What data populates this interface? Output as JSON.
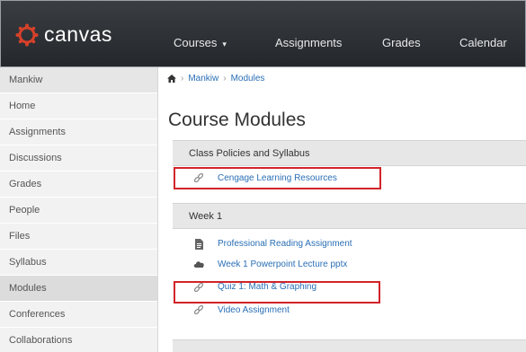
{
  "app": {
    "logo_text": "canvas",
    "accent": "#d6412a"
  },
  "topnav": {
    "items": [
      {
        "label": "Courses",
        "caret": "▾"
      },
      {
        "label": "Assignments"
      },
      {
        "label": "Grades"
      },
      {
        "label": "Calendar"
      }
    ]
  },
  "sidebar": {
    "course_name": "Mankiw",
    "items": [
      {
        "label": "Home"
      },
      {
        "label": "Assignments"
      },
      {
        "label": "Discussions"
      },
      {
        "label": "Grades"
      },
      {
        "label": "People"
      },
      {
        "label": "Files"
      },
      {
        "label": "Syllabus"
      },
      {
        "label": "Modules"
      },
      {
        "label": "Conferences"
      },
      {
        "label": "Collaborations"
      }
    ]
  },
  "breadcrumb": {
    "items": [
      "Mankiw",
      "Modules"
    ],
    "separator": "›"
  },
  "main": {
    "title": "Course Modules",
    "modules": [
      {
        "name": "Class Policies and Syllabus",
        "items": [
          {
            "label": "Cengage Learning Resources",
            "icon": "link-icon",
            "highlighted": true
          }
        ]
      },
      {
        "name": "Week 1",
        "items": [
          {
            "label": "Professional Reading Assignment",
            "icon": "document-icon",
            "highlighted": false
          },
          {
            "label": "Week 1 Powerpoint Lecture pptx",
            "icon": "cloud-icon",
            "highlighted": false
          },
          {
            "label": "Quiz 1: Math & Graphing",
            "icon": "link-icon",
            "highlighted": true
          },
          {
            "label": "Video Assignment",
            "icon": "link-icon",
            "highlighted": false
          }
        ]
      }
    ]
  },
  "colors": {
    "topbar": "#2b2e32",
    "link": "#2a6fb5",
    "highlight": "#d2232a"
  }
}
